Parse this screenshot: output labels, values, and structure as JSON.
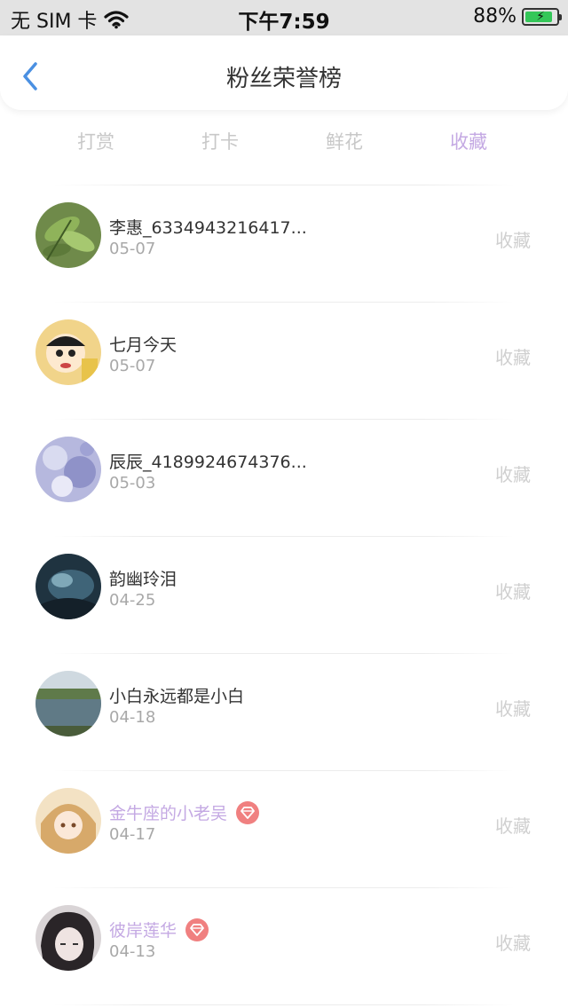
{
  "status_bar": {
    "carrier": "无 SIM 卡",
    "time": "下午7:59",
    "battery_percent": "88%",
    "battery_level": 0.88
  },
  "nav": {
    "title": "粉丝荣誉榜",
    "back_icon": "chevron-left-icon"
  },
  "tabs": [
    {
      "label": "打赏",
      "active": false
    },
    {
      "label": "打卡",
      "active": false
    },
    {
      "label": "鲜花",
      "active": false
    },
    {
      "label": "收藏",
      "active": true
    }
  ],
  "colors": {
    "accent": "#c4a9e3",
    "back_icon": "#4a90e2",
    "vip_badge": "#f08080"
  },
  "items": [
    {
      "name": "李惠_6334943216417...",
      "date": "05-07",
      "action": "收藏",
      "vip": false
    },
    {
      "name": "七月今天",
      "date": "05-07",
      "action": "收藏",
      "vip": false
    },
    {
      "name": "辰辰_4189924674376...",
      "date": "05-03",
      "action": "收藏",
      "vip": false
    },
    {
      "name": "韵幽玲泪",
      "date": "04-25",
      "action": "收藏",
      "vip": false
    },
    {
      "name": "小白永远都是小白",
      "date": "04-18",
      "action": "收藏",
      "vip": false
    },
    {
      "name": "金牛座的小老吴",
      "date": "04-17",
      "action": "收藏",
      "vip": true
    },
    {
      "name": "彼岸莲华",
      "date": "04-13",
      "action": "收藏",
      "vip": true
    }
  ]
}
